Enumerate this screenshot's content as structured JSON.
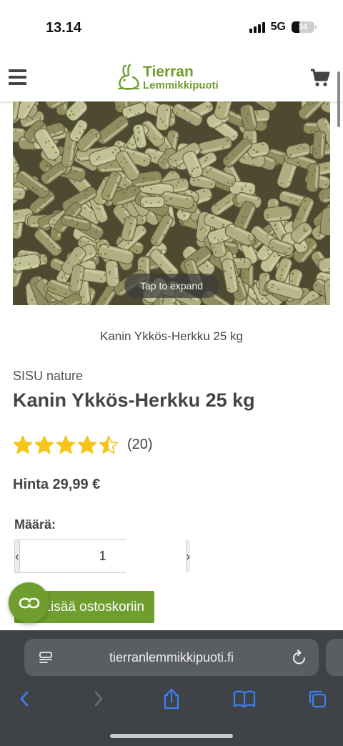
{
  "status_bar": {
    "time": "13.14",
    "network": "5G",
    "battery": "34"
  },
  "header": {
    "logo_line1": "Tierran",
    "logo_line2": "Lemmikkipuoti",
    "menu_icon": "hamburger-menu-icon",
    "cart_icon": "shopping-cart-icon"
  },
  "gallery": {
    "expand_label": "Tap to expand",
    "caption": "Kanin Ykkös-Herkku 25 kg"
  },
  "product": {
    "brand": "SISU nature",
    "title": "Kanin Ykkös-Herkku 25 kg",
    "rating": 4.5,
    "rating_max": 5,
    "review_count": "(20)",
    "price": "Hinta 29,99 €"
  },
  "quantity": {
    "label": "Määrä:",
    "value": "1",
    "decrement": "‹",
    "increment": "›"
  },
  "add_to_cart": {
    "label": "Lisää ostoskoriin"
  },
  "browser": {
    "url": "tierranlemmikkipuoti.fi"
  },
  "colors": {
    "brand_green": "#6f9e2f",
    "star_yellow": "#f5c518",
    "browser_bg": "#3f4246",
    "link_blue": "#3b82f6"
  }
}
